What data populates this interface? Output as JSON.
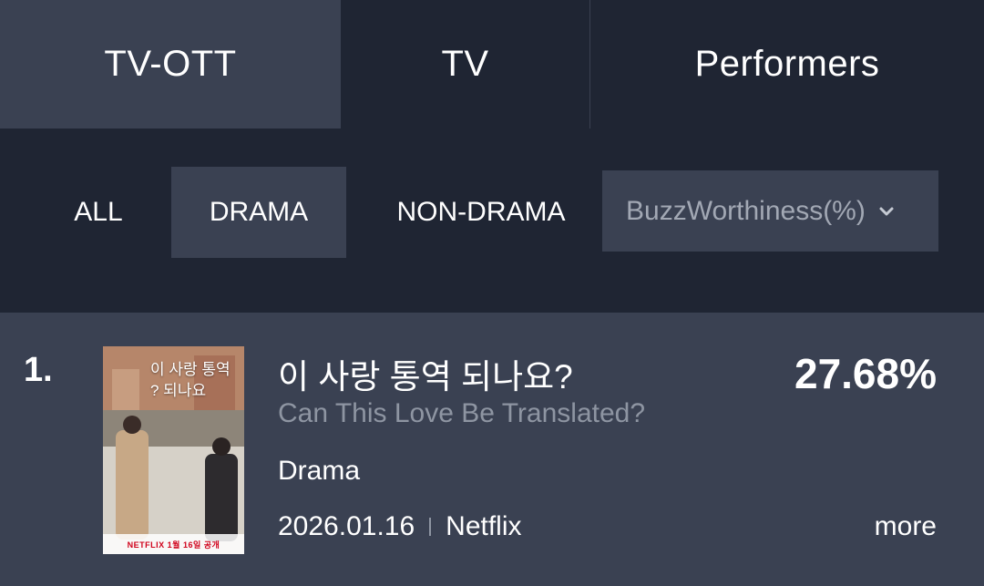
{
  "top_tabs": [
    {
      "label": "TV-OTT"
    },
    {
      "label": "TV"
    },
    {
      "label": "Performers"
    }
  ],
  "filters": {
    "all": "ALL",
    "drama": "DRAMA",
    "non_drama": "NON-DRAMA",
    "metric_select": "BuzzWorthiness(%)"
  },
  "colors": {
    "background": "#1f2533",
    "selected": "#3a4152",
    "muted_text": "#8e95a2"
  },
  "ranking": [
    {
      "rank": "1.",
      "poster_icon": "poster-image",
      "poster_title": "이 사랑 통역 ? 되나요",
      "poster_footer": "NETFLIX  1월 16일 공개",
      "title_ko": "이 사랑 통역 되나요?",
      "title_en": "Can This Love Be Translated?",
      "genre": "Drama",
      "date": "2026.01.16",
      "platform": "Netflix",
      "score": "27.68%",
      "more": "more"
    }
  ]
}
